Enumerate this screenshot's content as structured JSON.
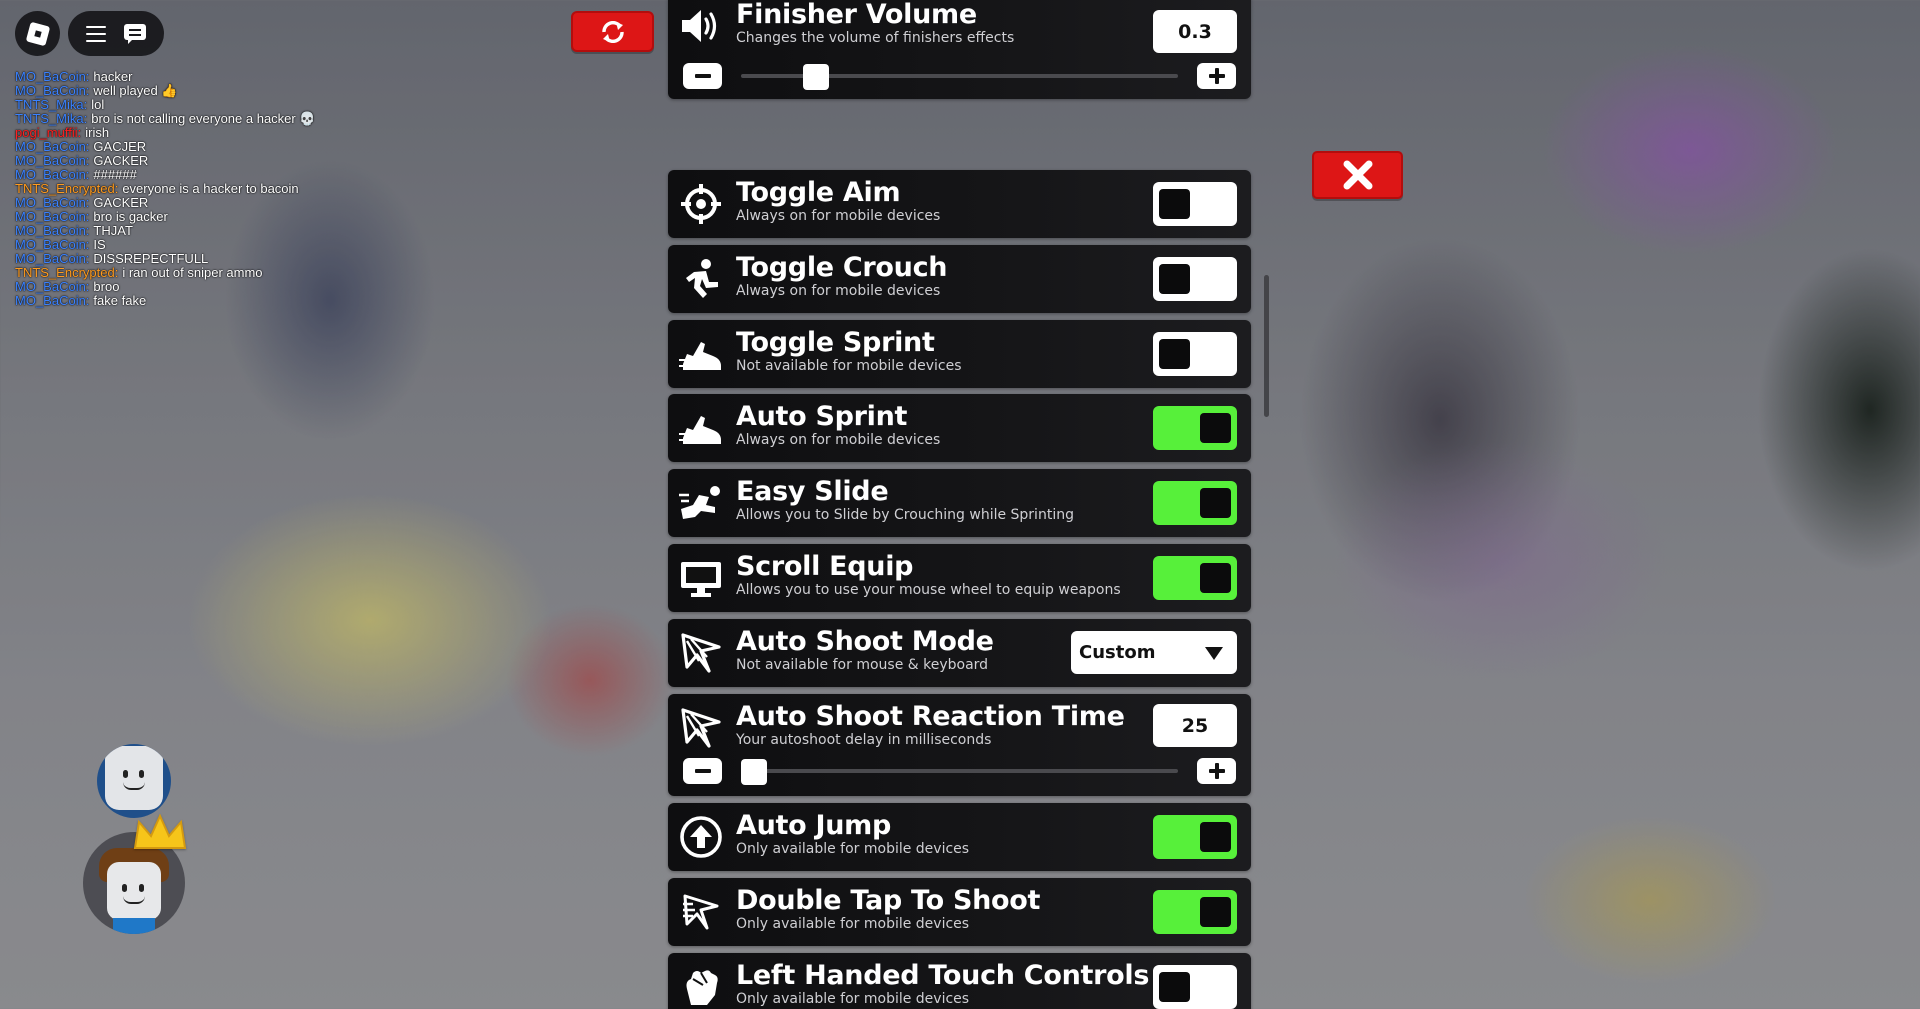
{
  "colors": {
    "toggle_on": "#57f03a",
    "toggle_off": "#ffffff",
    "card_bg": "#121214",
    "red_button": "#dd1616",
    "chat_name_blue": "#3b82ff",
    "chat_name_orange": "#ff9b1f",
    "chat_name_red": "#ff2020"
  },
  "topbar": {
    "logo_icon": "roblox-logo-icon",
    "menu_icon": "hamburger-menu-icon",
    "chat_icon": "chat-bubble-icon"
  },
  "chat": {
    "messages": [
      {
        "name": "MO_BaCoin:",
        "text": "hacker",
        "name_color": "#3b82ff"
      },
      {
        "name": "MO_BaCoin:",
        "text": "well played 👍",
        "name_color": "#3b82ff"
      },
      {
        "name": "TNTS_Mika:",
        "text": "lol",
        "name_color": "#3b82ff"
      },
      {
        "name": "TNTS_Mika:",
        "text": "bro is not calling everyone a hacker 💀",
        "name_color": "#3b82ff"
      },
      {
        "name": "pogi_muffii:",
        "text": "irish",
        "name_color": "#ff2020"
      },
      {
        "name": "MO_BaCoin:",
        "text": "GACJER",
        "name_color": "#3b82ff"
      },
      {
        "name": "MO_BaCoin:",
        "text": "GACKER",
        "name_color": "#3b82ff"
      },
      {
        "name": "MO_BaCoin:",
        "text": "######",
        "name_color": "#3b82ff"
      },
      {
        "name": "TNTS_Encrypted:",
        "text": "everyone is a hacker to bacoin",
        "name_color": "#ff9b1f"
      },
      {
        "name": "MO_BaCoin:",
        "text": "GACKER",
        "name_color": "#3b82ff"
      },
      {
        "name": "MO_BaCoin:",
        "text": "bro is gacker",
        "name_color": "#3b82ff"
      },
      {
        "name": "MO_BaCoin:",
        "text": "THJAT",
        "name_color": "#3b82ff"
      },
      {
        "name": "MO_BaCoin:",
        "text": "IS",
        "name_color": "#3b82ff"
      },
      {
        "name": "MO_BaCoin:",
        "text": "DISSREPECTFULL",
        "name_color": "#3b82ff"
      },
      {
        "name": "TNTS_Encrypted:",
        "text": "i ran out of sniper ammo",
        "name_color": "#ff9b1f"
      },
      {
        "name": "MO_BaCoin:",
        "text": "broo",
        "name_color": "#3b82ff"
      },
      {
        "name": "MO_BaCoin:",
        "text": "fake fake",
        "name_color": "#3b82ff"
      }
    ]
  },
  "buttons": {
    "reset_icon": "refresh-icon",
    "close_icon": "close-x-icon"
  },
  "settings": {
    "finisher_volume": {
      "title": "Finisher Volume",
      "desc": "Changes the volume of finishers effects",
      "value": "0.3",
      "icon": "speaker-icon",
      "level": 0.15
    },
    "toggle_aim": {
      "title": "Toggle Aim",
      "desc": "Always on for mobile devices",
      "on": false,
      "icon": "crosshair-icon"
    },
    "toggle_crouch": {
      "title": "Toggle Crouch",
      "desc": "Always on for mobile devices",
      "on": false,
      "icon": "crouch-icon"
    },
    "toggle_sprint": {
      "title": "Toggle Sprint",
      "desc": "Not available for mobile devices",
      "on": false,
      "icon": "sprint-shoe-icon"
    },
    "auto_sprint": {
      "title": "Auto Sprint",
      "desc": "Always on for mobile devices",
      "on": true,
      "icon": "sprint-shoe-icon"
    },
    "easy_slide": {
      "title": "Easy Slide",
      "desc": "Allows you to Slide by Crouching while Sprinting",
      "on": true,
      "icon": "slide-icon"
    },
    "scroll_equip": {
      "title": "Scroll Equip",
      "desc": "Allows you to use your mouse wheel to equip weapons",
      "on": true,
      "icon": "monitor-icon"
    },
    "auto_shoot_mode": {
      "title": "Auto Shoot Mode",
      "desc": "Not available for mouse & keyboard",
      "selected": "Custom",
      "icon": "auto-shoot-icon"
    },
    "auto_shoot_reaction": {
      "title": "Auto Shoot Reaction Time",
      "desc": "Your autoshoot delay in milliseconds",
      "value": "25",
      "icon": "auto-shoot-icon",
      "level": 0.0
    },
    "auto_jump": {
      "title": "Auto Jump",
      "desc": "Only available for mobile devices",
      "on": true,
      "icon": "arrow-up-circle-icon"
    },
    "double_tap_shoot": {
      "title": "Double Tap To Shoot",
      "desc": "Only available for mobile devices",
      "on": true,
      "icon": "double-tap-icon"
    },
    "left_handed": {
      "title": "Left Handed Touch Controls",
      "desc": "Only available for mobile devices",
      "on": false,
      "icon": "left-hand-icon"
    }
  }
}
